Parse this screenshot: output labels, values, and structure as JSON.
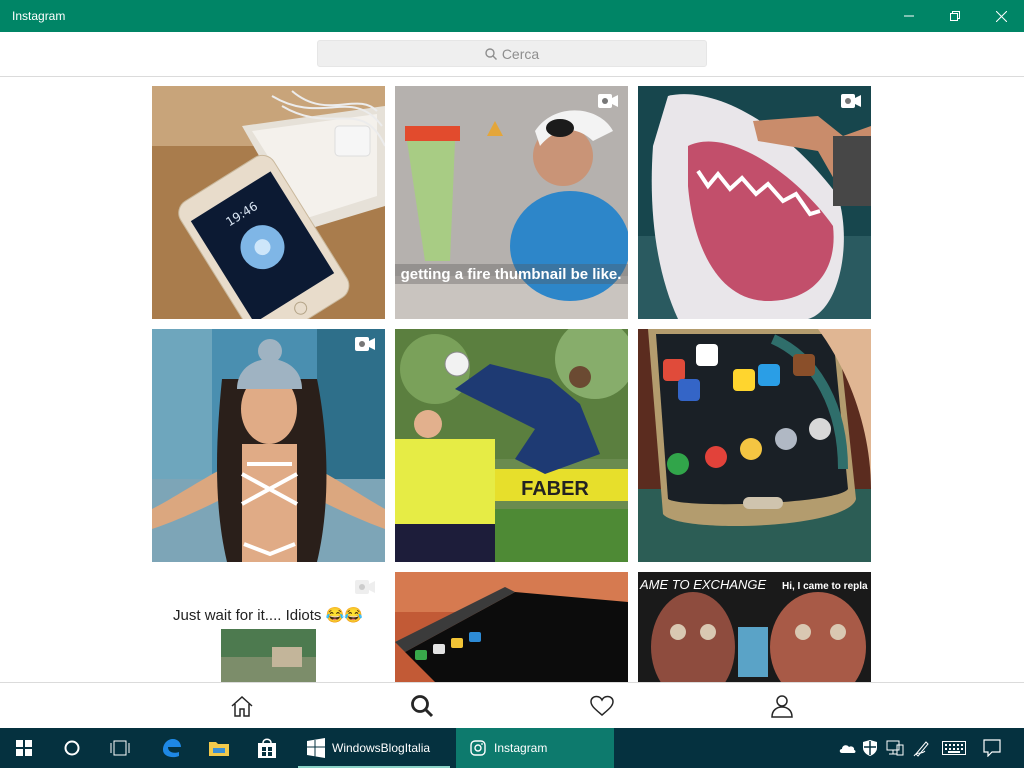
{
  "window": {
    "title": "Instagram",
    "accent_color": "#008566"
  },
  "search": {
    "placeholder": "Cerca"
  },
  "grid": {
    "tiles": [
      {
        "subject": "gold iPhone on wooden table with box",
        "video": false
      },
      {
        "subject": "man with cap holding green sock",
        "caption": "getting a fire thumbnail be like.",
        "video": true
      },
      {
        "subject": "great white shark with open jaws",
        "video": true
      },
      {
        "subject": "woman in white lingerie and knit hat",
        "video": true
      },
      {
        "subject": "soccer players bicycle kick",
        "video": false
      },
      {
        "subject": "hand holding Samsung Galaxy phone",
        "video": false
      },
      {
        "subject": "meme text with video thumbnail",
        "caption": "Just wait for it.... Idiots 😂😂",
        "video": true
      },
      {
        "subject": "black phones stacked",
        "video": false
      },
      {
        "subject": "face paint meme",
        "caption_left": "AME TO EXCHANGE",
        "caption_right": "Hi, I came to repla",
        "video": false
      }
    ]
  },
  "bottom_nav": {
    "items": [
      "home-icon",
      "search-icon",
      "heart-icon",
      "profile-icon"
    ],
    "active": "search-icon"
  },
  "taskbar": {
    "apps": [
      {
        "label": "WindowsBlogItalia",
        "icon": "window-icon",
        "active": false
      },
      {
        "label": "Instagram",
        "icon": "instagram-icon",
        "active": true
      }
    ],
    "pinned": [
      "start-icon",
      "cortana-icon",
      "task-view-icon",
      "edge-icon",
      "file-explorer-icon",
      "store-icon"
    ],
    "tray": [
      "onedrive-icon",
      "defender-icon",
      "network-icon",
      "pen-icon",
      "keyboard-icon",
      "notifications-icon"
    ]
  }
}
